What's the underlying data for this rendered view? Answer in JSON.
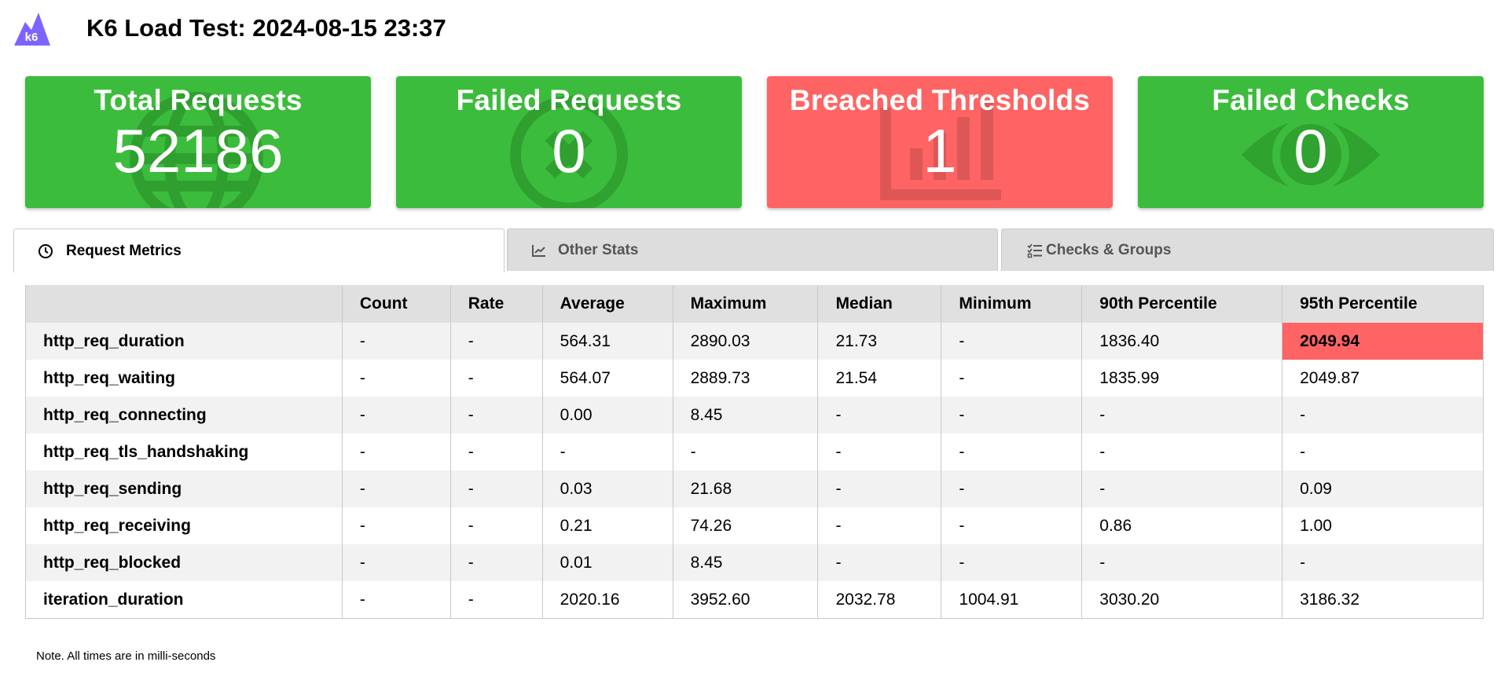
{
  "header": {
    "logo_text": "k6",
    "title": "K6 Load Test: 2024-08-15 23:37"
  },
  "colors": {
    "success": "#3cbc3c",
    "failure": "#ff6464",
    "logo": "#7d64ff"
  },
  "cards": [
    {
      "title": "Total Requests",
      "value": "52186",
      "status": "ok",
      "icon": "globe-icon"
    },
    {
      "title": "Failed Requests",
      "value": "0",
      "status": "ok",
      "icon": "times-circle-icon"
    },
    {
      "title": "Breached Thresholds",
      "value": "1",
      "status": "bad",
      "icon": "bar-chart-icon"
    },
    {
      "title": "Failed Checks",
      "value": "0",
      "status": "ok",
      "icon": "eye-icon"
    }
  ],
  "tabs": [
    {
      "label": "Request Metrics",
      "icon": "clock-icon",
      "active": true
    },
    {
      "label": "Other Stats",
      "icon": "line-chart-icon",
      "active": false
    },
    {
      "label": "Checks & Groups",
      "icon": "tasks-icon",
      "active": false
    }
  ],
  "table": {
    "columns": [
      "",
      "Count",
      "Rate",
      "Average",
      "Maximum",
      "Median",
      "Minimum",
      "90th Percentile",
      "95th Percentile"
    ],
    "rows": [
      [
        "http_req_duration",
        "-",
        "-",
        "564.31",
        "2890.03",
        "21.73",
        "-",
        "1836.40",
        "2049.94"
      ],
      [
        "http_req_waiting",
        "-",
        "-",
        "564.07",
        "2889.73",
        "21.54",
        "-",
        "1835.99",
        "2049.87"
      ],
      [
        "http_req_connecting",
        "-",
        "-",
        "0.00",
        "8.45",
        "-",
        "-",
        "-",
        "-"
      ],
      [
        "http_req_tls_handshaking",
        "-",
        "-",
        "-",
        "-",
        "-",
        "-",
        "-",
        "-"
      ],
      [
        "http_req_sending",
        "-",
        "-",
        "0.03",
        "21.68",
        "-",
        "-",
        "-",
        "0.09"
      ],
      [
        "http_req_receiving",
        "-",
        "-",
        "0.21",
        "74.26",
        "-",
        "-",
        "0.86",
        "1.00"
      ],
      [
        "http_req_blocked",
        "-",
        "-",
        "0.01",
        "8.45",
        "-",
        "-",
        "-",
        "-"
      ],
      [
        "iteration_duration",
        "-",
        "-",
        "2020.16",
        "3952.60",
        "2032.78",
        "1004.91",
        "3030.20",
        "3186.32"
      ]
    ],
    "breached_cell": {
      "row": 0,
      "col": 8
    }
  },
  "note": "Note. All times are in milli-seconds"
}
